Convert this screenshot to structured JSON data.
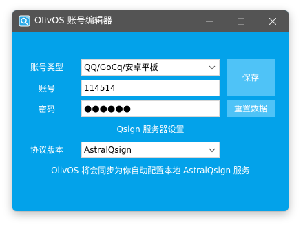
{
  "window": {
    "title": "OlivOS 账号编辑器",
    "accent_color": "#03a2ea",
    "titlebar_color": "#545454",
    "controls": [
      "minimize-icon",
      "maximize-icon",
      "close-icon"
    ]
  },
  "account": {
    "type_label": "账号类型",
    "type_value": "QQ/GoCq/安卓平板",
    "id_label": "账号",
    "id_value": "114514",
    "password_label": "密码",
    "password_value": "●●●●●●"
  },
  "buttons": {
    "save": "保存",
    "reset": "重置数据"
  },
  "qsign": {
    "section_title": "Qsign 服务器设置",
    "protocol_label": "协议版本",
    "protocol_value": "AstralQsign",
    "info_text": "OlivOS 将会同步为你自动配置本地 AstralQsign 服务"
  }
}
